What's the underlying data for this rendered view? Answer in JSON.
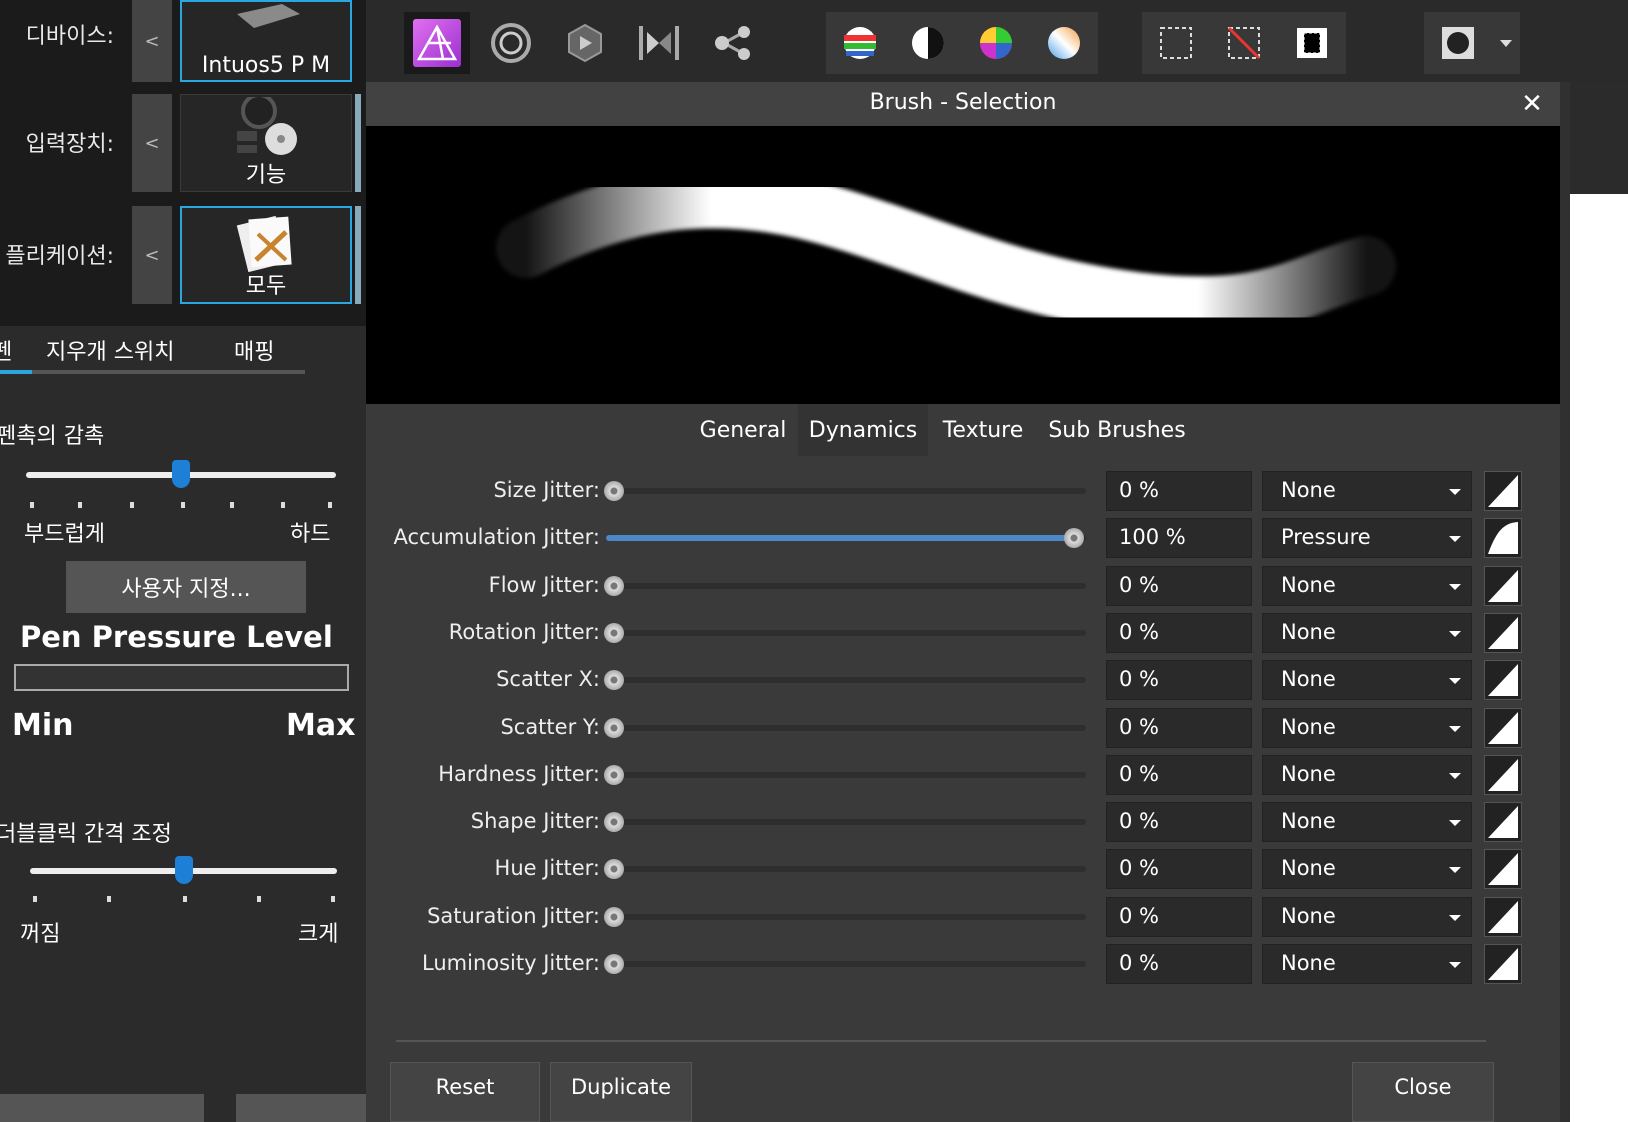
{
  "left": {
    "rows": [
      {
        "label": "디바이스:",
        "tile": "Intuos5 P M"
      },
      {
        "label": "입력장치:",
        "tile": "기능"
      },
      {
        "label": "플리케이션:",
        "tile": "모두"
      }
    ],
    "chevron": "<",
    "tabs": [
      "펜",
      "지우개 스위치",
      "매핑"
    ],
    "tip_feel": {
      "label": "펜촉의 감촉",
      "min": "부드럽게",
      "max": "하드",
      "value": 0.5
    },
    "customize": "사용자 지정...",
    "pressure": {
      "title": "Pen Pressure Level",
      "min": "Min",
      "max": "Max"
    },
    "dblclick": {
      "label": "더블클릭 간격 조정",
      "min": "꺼짐",
      "max": "크게",
      "value": 0.5
    }
  },
  "toolbar": {
    "personas": [
      "photo-persona-icon",
      "liquify-persona-icon",
      "develop-persona-icon",
      "tone-mapping-persona-icon",
      "export-persona-icon"
    ],
    "adjust": [
      "levels-icon",
      "contrast-icon",
      "color-wheel-icon",
      "white-balance-icon"
    ],
    "select": [
      "select-all-icon",
      "deselect-icon",
      "invert-selection-icon"
    ],
    "mask": "quick-mask-icon"
  },
  "dialog": {
    "title": "Brush - Selection",
    "close_x": "✕",
    "tabs": [
      "General",
      "Dynamics",
      "Texture",
      "Sub Brushes"
    ],
    "active_tab": "Dynamics",
    "rows": [
      {
        "label": "Size Jitter:",
        "value": "0 %",
        "pct": 0,
        "controller": "None"
      },
      {
        "label": "Accumulation Jitter:",
        "value": "100 %",
        "pct": 100,
        "controller": "Pressure"
      },
      {
        "label": "Flow Jitter:",
        "value": "0 %",
        "pct": 0,
        "controller": "None"
      },
      {
        "label": "Rotation Jitter:",
        "value": "0 %",
        "pct": 0,
        "controller": "None"
      },
      {
        "label": "Scatter X:",
        "value": "0 %",
        "pct": 0,
        "controller": "None"
      },
      {
        "label": "Scatter Y:",
        "value": "0 %",
        "pct": 0,
        "controller": "None"
      },
      {
        "label": "Hardness Jitter:",
        "value": "0 %",
        "pct": 0,
        "controller": "None"
      },
      {
        "label": "Shape Jitter:",
        "value": "0 %",
        "pct": 0,
        "controller": "None"
      },
      {
        "label": "Hue Jitter:",
        "value": "0 %",
        "pct": 0,
        "controller": "None"
      },
      {
        "label": "Saturation Jitter:",
        "value": "0 %",
        "pct": 0,
        "controller": "None"
      },
      {
        "label": "Luminosity Jitter:",
        "value": "0 %",
        "pct": 0,
        "controller": "None"
      }
    ],
    "buttons": {
      "reset": "Reset",
      "duplicate": "Duplicate",
      "close": "Close"
    }
  },
  "colors": {
    "accent": "#4d87c7",
    "wacom_blue": "#1e7fd6",
    "selection_border": "#2aa6e0",
    "affinity_purple": "#c545e8"
  }
}
